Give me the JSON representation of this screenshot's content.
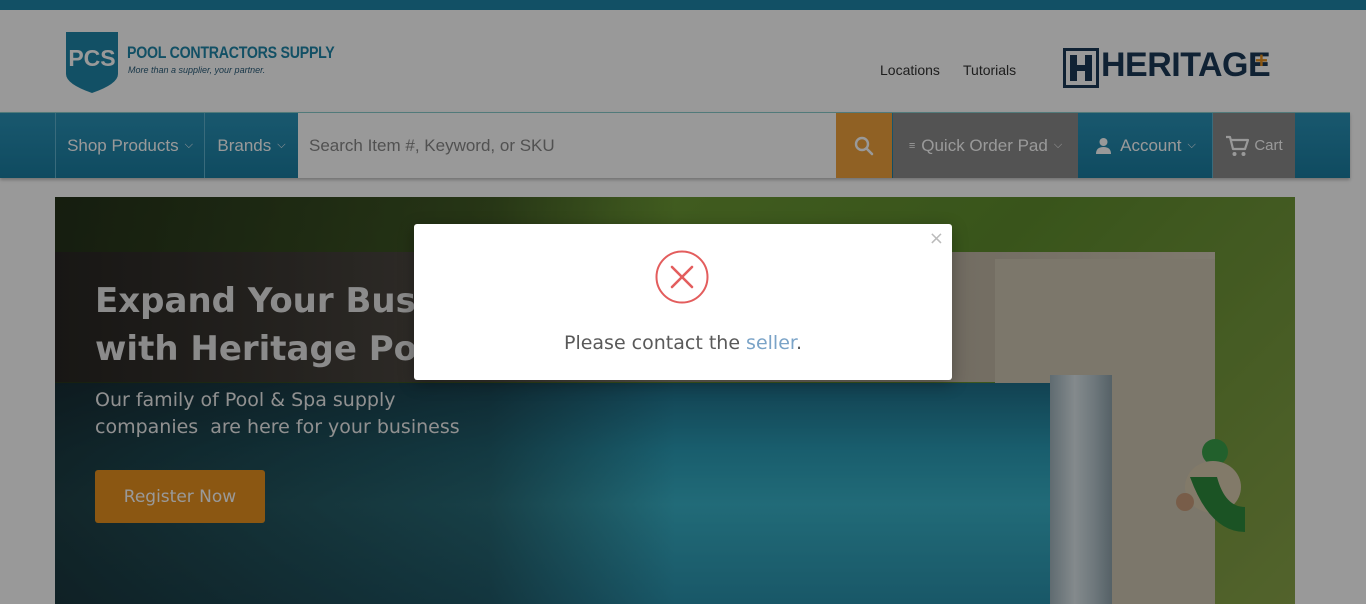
{
  "header": {
    "logo": {
      "mark": "PCS",
      "name": "POOL CONTRACTORS SUPPLY",
      "tagline": "More than a supplier, your partner."
    },
    "links": [
      "Locations",
      "Tutorials"
    ],
    "heritage": {
      "word": "HERITAGE",
      "plus": "+"
    }
  },
  "nav": {
    "shop_products": "Shop Products",
    "brands": "Brands",
    "search_placeholder": "Search Item #, Keyword, or SKU",
    "quick_order": "Quick Order Pad",
    "account": "Account",
    "cart": "Cart"
  },
  "hero": {
    "title_line1": "Expand Your Busin",
    "title_line2": "with Heritage Pool",
    "sub_line1": "Our family of Pool & Spa supply",
    "sub_line2": "companies  are here for your business",
    "cta": "Register Now"
  },
  "modal": {
    "message_prefix": "Please contact the ",
    "message_link": "seller",
    "message_suffix": ".",
    "close": "×"
  },
  "colors": {
    "brand_blue": "#1f86a8",
    "accent_orange": "#e8911e",
    "error_red": "#e35d5d"
  }
}
